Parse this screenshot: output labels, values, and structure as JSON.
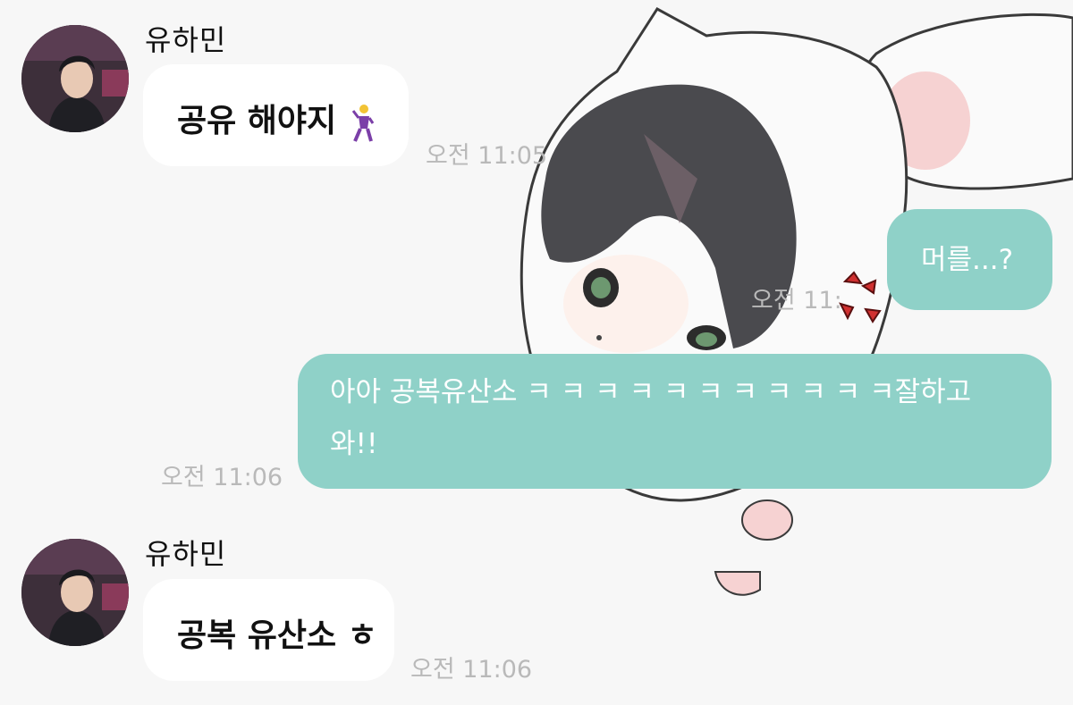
{
  "messages": [
    {
      "sender": "유하민",
      "direction": "incoming",
      "text": "공유 해야지",
      "emoji": "dancer-emoji",
      "time": "오전 11:05"
    },
    {
      "direction": "outgoing",
      "text": "머를...?",
      "time": "오전 11:"
    },
    {
      "direction": "outgoing",
      "text_line1": "아아 공복유산소 ㅋ ㅋ ㅋ ㅋ ㅋ ㅋ ㅋ ㅋ ㅋ ㅋ ㅋ잘하고",
      "text_line2": "와!!",
      "time": "오전 11:06"
    },
    {
      "sender": "유하민",
      "direction": "incoming",
      "text": "공복 유산소 ㅎ",
      "time": "오전 11:06"
    }
  ],
  "colors": {
    "background": "#f7f7f7",
    "incoming_bubble": "#ffffff",
    "outgoing_bubble": "#8fd1c8",
    "timestamp": "#b9b9b9"
  }
}
